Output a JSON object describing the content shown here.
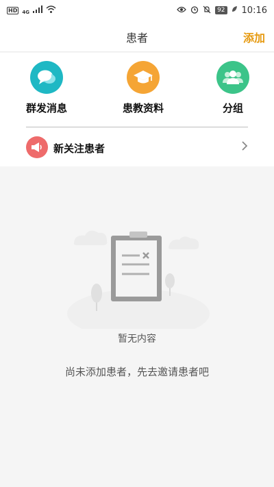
{
  "status_bar": {
    "hd": "HD",
    "network": "4G",
    "battery": "92",
    "time": "10:16"
  },
  "nav": {
    "title": "患者",
    "add_label": "添加"
  },
  "quick_actions": [
    {
      "label": "群发消息",
      "icon": "chat-bubbles-icon",
      "color": "#1fb8c4"
    },
    {
      "label": "患教资料",
      "icon": "graduation-cap-icon",
      "color": "#f5a535"
    },
    {
      "label": "分组",
      "icon": "group-users-icon",
      "color": "#3cc489"
    }
  ],
  "follow": {
    "label": "新关注患者",
    "icon": "megaphone-icon",
    "color": "#ee6b6b"
  },
  "empty_state": {
    "title": "暂无内容",
    "description": "尚未添加患者，先去邀请患者吧"
  },
  "colors": {
    "accent": "#e69a11",
    "background": "#f5f5f5"
  }
}
